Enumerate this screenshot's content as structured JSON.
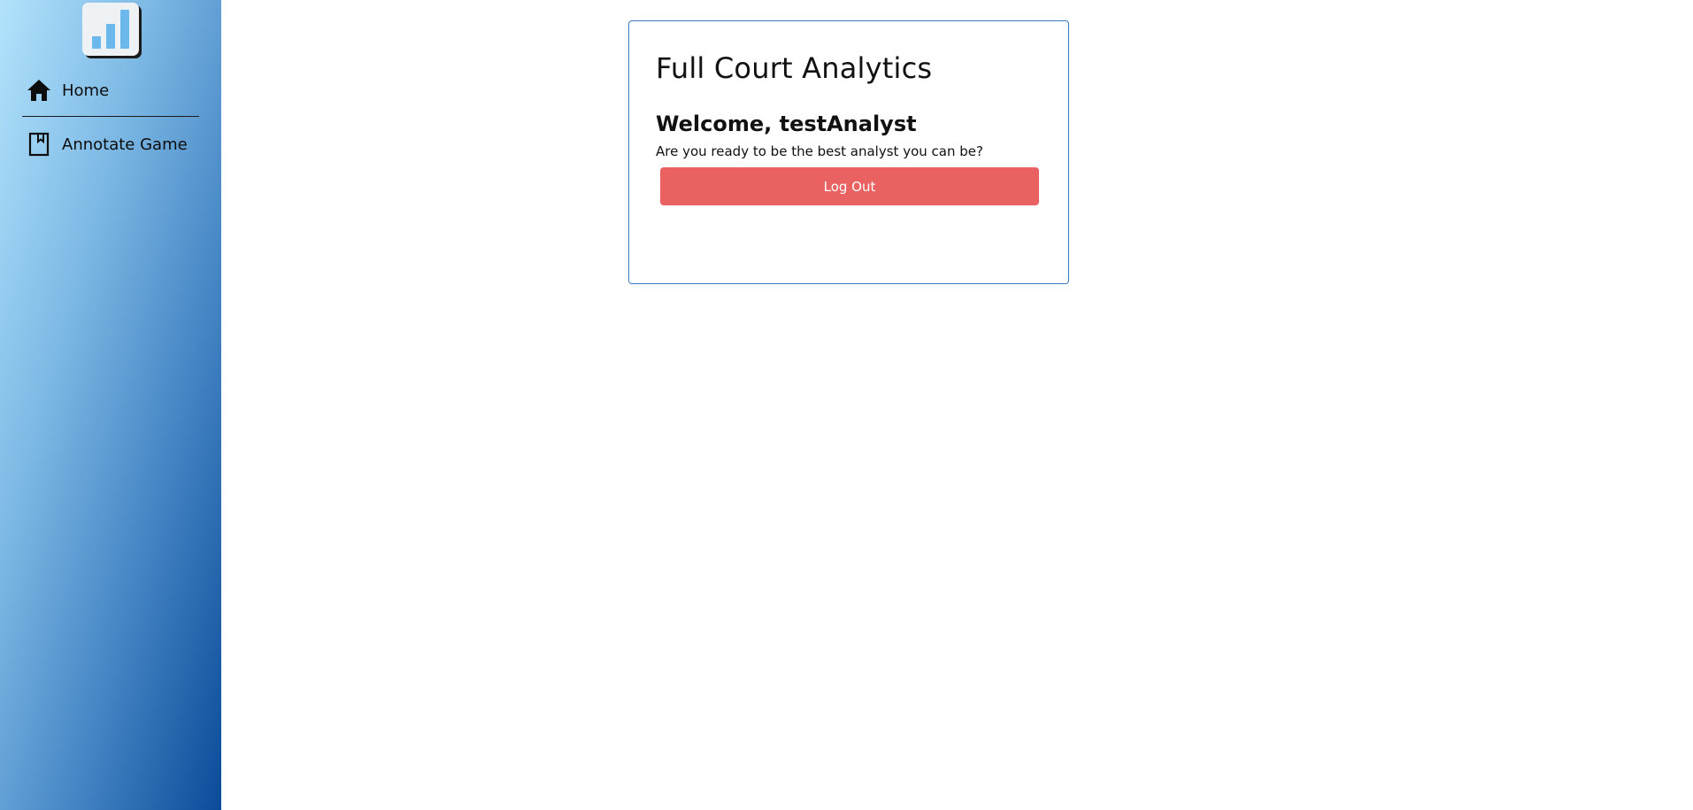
{
  "sidebar": {
    "logo_icon": "bar-chart-icon",
    "items": [
      {
        "label": "Home",
        "icon": "home-icon"
      },
      {
        "label": "Annotate Game",
        "icon": "bookmark-page-icon"
      }
    ]
  },
  "main": {
    "title": "Full Court Analytics",
    "welcome": "Welcome, testAnalyst",
    "subtitle": "Are you ready to be the best analyst you can be?",
    "logout_label": "Log Out"
  },
  "colors": {
    "logout_button": "#ea6162",
    "card_border": "#3a7bbf",
    "logo_bars": "#6ab8ec",
    "sidebar_gradient_start": "#b3e3fc",
    "sidebar_gradient_end": "#0a4b99"
  }
}
